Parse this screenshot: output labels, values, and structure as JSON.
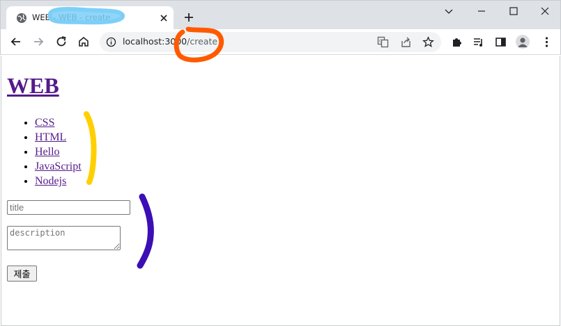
{
  "browser": {
    "tab_title": "WEB - WEB - create",
    "url_host": "localhost:3000",
    "url_path": "/create",
    "icons": [
      "globe-icon",
      "close-icon",
      "plus-icon",
      "minimize-icon",
      "maximize-icon",
      "window-close-icon",
      "back-icon",
      "forward-icon",
      "reload-icon",
      "home-icon",
      "info-icon",
      "translate-icon",
      "share-icon",
      "star-icon",
      "extensions-icon",
      "reading-list-icon",
      "side-panel-icon",
      "profile-icon",
      "menu-icon"
    ]
  },
  "page": {
    "title": "WEB",
    "topics": [
      "CSS",
      "HTML",
      "Hello",
      "JavaScript",
      "Nodejs"
    ],
    "form": {
      "title_placeholder": "title",
      "description_placeholder": "description",
      "submit_label": "제출"
    }
  },
  "annotations": {
    "colors": {
      "tab_highlight": "#7dcff7",
      "url_circle": "#ff5a00",
      "list_bracket": "#ffd000",
      "form_bracket": "#3b0fb5"
    }
  }
}
